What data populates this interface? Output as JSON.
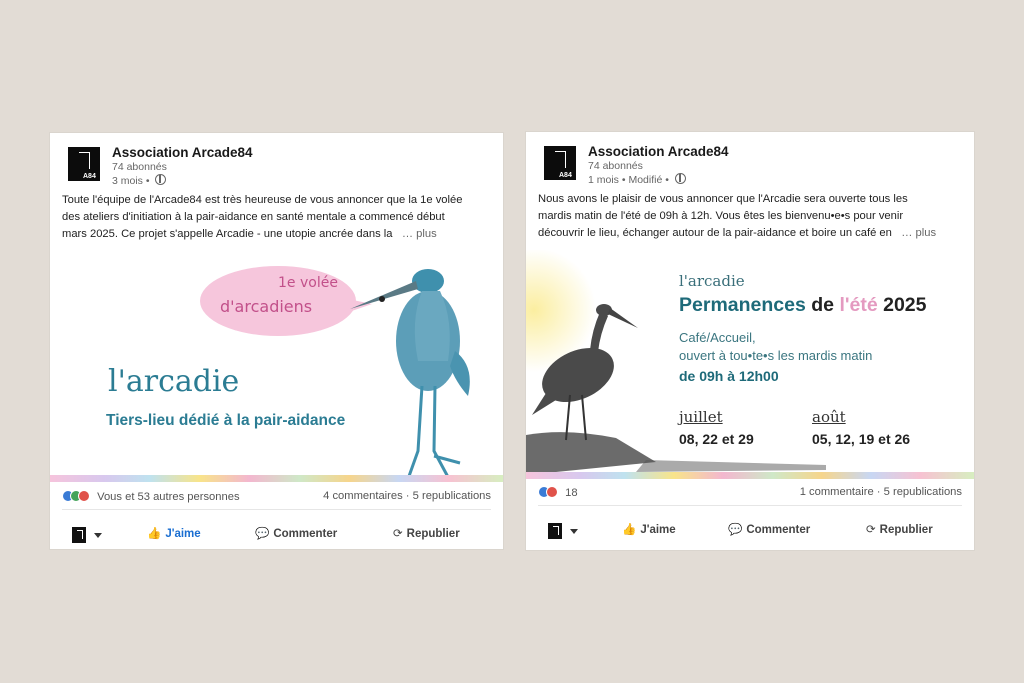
{
  "posts": [
    {
      "org": "Association Arcade84",
      "followers": "74 abonnés",
      "age": "3 mois",
      "modified": "",
      "logo_text": "A84",
      "text_lines": [
        "Toute l'équipe de l'Arcade84 est très heureuse de vous annoncer que la 1e volée",
        "des ateliers d'initiation à la pair-aidance en santé mentale a commencé début",
        "mars 2025. Ce projet s'appelle Arcadie - une utopie ancrée dans la"
      ],
      "more": "… plus",
      "image": {
        "bubble_line1": "1e volée",
        "bubble_line2": "d'arcadiens",
        "title": "l'arcadie",
        "subtitle": "Tiers-lieu dédié à la pair-aidance"
      },
      "reactions_text": "Vous et 53 autres personnes",
      "stats": "4 commentaires · 5 republications",
      "actions": {
        "like": "J'aime",
        "comment": "Commenter",
        "repost": "Republier"
      },
      "liked": true
    },
    {
      "org": "Association Arcade84",
      "followers": "74 abonnés",
      "age": "1 mois",
      "modified": "Modifié",
      "logo_text": "A84",
      "text_lines": [
        "Nous avons le plaisir de vous annoncer que l'Arcadie sera ouverte tous les",
        "mardis matin de l'été de 09h à 12h. Vous êtes les bienvenu•e•s pour venir",
        "découvrir le lieu, échanger autour de la pair-aidance et boire un café en"
      ],
      "more": "… plus",
      "image": {
        "small_title": "l'arcadie",
        "head_1": "Permanences",
        "head_2": "de",
        "head_3": "l'été",
        "head_4": "2025",
        "line1": "Café/Accueil,",
        "line2": "ouvert à tou•te•s les mardis matin",
        "hours": "de 09h à 12h00",
        "month1": "juillet",
        "dates1": "08, 22 et 29",
        "month2": "août",
        "dates2": "05, 12, 19 et 26"
      },
      "reactions_text": "18",
      "stats": "1 commentaire · 5 republications",
      "actions": {
        "like": "J'aime",
        "comment": "Commenter",
        "repost": "Republier"
      },
      "liked": false
    }
  ],
  "colors": {
    "background": "#e2dcd5",
    "teal": "#2b7c93",
    "pink": "#e49ac0",
    "like_blue": "#1a6ed1"
  }
}
